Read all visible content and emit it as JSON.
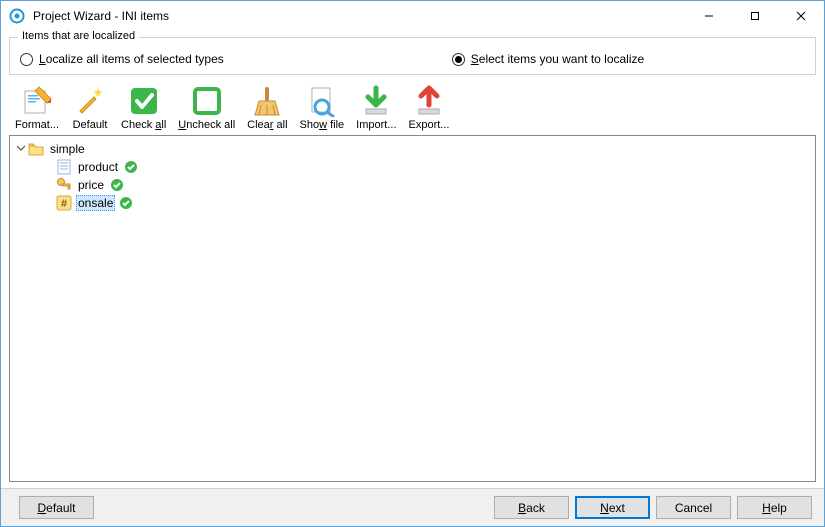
{
  "window": {
    "title": "Project Wizard - INI items"
  },
  "group": {
    "legend": "Items that are localized",
    "opt_localize_all": {
      "pre": "L",
      "rest": "ocalize all items of selected types",
      "selected": false
    },
    "opt_select_items": {
      "pre": "S",
      "rest": "elect items you want to localize",
      "selected": true
    }
  },
  "toolbar": {
    "format": {
      "label_plain": "Format..."
    },
    "default": {
      "label_plain": "Default"
    },
    "checkall": {
      "label_pre": "Check ",
      "label_mn": "a",
      "label_post": "ll"
    },
    "uncheckall": {
      "label_pre": "",
      "label_mn": "U",
      "label_post": "ncheck all"
    },
    "clearall": {
      "label_pre": "Clea",
      "label_mn": "r",
      "label_post": " all"
    },
    "showfile": {
      "label_pre": "Sho",
      "label_mn": "w",
      "label_post": " file"
    },
    "import": {
      "label_plain": "Import..."
    },
    "export": {
      "label_plain": "Export..."
    }
  },
  "tree": {
    "root": {
      "label": "simple",
      "expanded": true
    },
    "items": [
      {
        "label": "product",
        "type": "text",
        "checked": true,
        "selected": false
      },
      {
        "label": "price",
        "type": "key",
        "checked": true,
        "selected": false
      },
      {
        "label": "onsale",
        "type": "hash",
        "checked": true,
        "selected": true
      }
    ]
  },
  "buttons": {
    "default": {
      "mn": "D",
      "rest": "efault"
    },
    "back": {
      "mn": "B",
      "rest": "ack"
    },
    "next": {
      "mn": "N",
      "rest": "ext"
    },
    "cancel": {
      "plain": "Cancel"
    },
    "help": {
      "mn": "H",
      "rest": "elp"
    }
  }
}
